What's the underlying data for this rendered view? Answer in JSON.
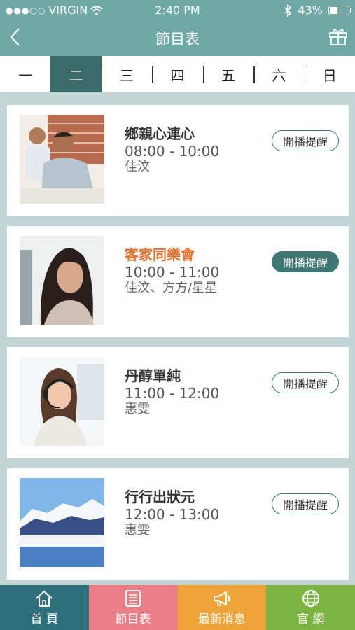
{
  "status": {
    "carrier": "VIRGIN",
    "time": "2:40 PM",
    "battery": "43%",
    "battery_level": 0.43
  },
  "nav": {
    "title": "節目表",
    "back_icon": "chevron-left-icon",
    "right_icon": "gift-icon"
  },
  "days": [
    {
      "label": "一",
      "active": false
    },
    {
      "label": "二",
      "active": true
    },
    {
      "label": "三",
      "active": false
    },
    {
      "label": "四",
      "active": false
    },
    {
      "label": "五",
      "active": false
    },
    {
      "label": "六",
      "active": false
    },
    {
      "label": "日",
      "active": false
    }
  ],
  "programs": [
    {
      "name": "鄉親心連心",
      "time": "08:00 - 10:00",
      "host": "佳汶",
      "remind": "開播提醒",
      "on_air": false
    },
    {
      "name": "客家同樂會",
      "time": "10:00 - 11:00",
      "host": "佳汶、方方/星星",
      "remind": "開播提醒",
      "on_air": true
    },
    {
      "name": "丹醇單純",
      "time": "11:00 - 12:00",
      "host": "惠雯",
      "remind": "開播提醒",
      "on_air": false
    },
    {
      "name": "行行出狀元",
      "time": "12:00 - 13:00",
      "host": "惠雯",
      "remind": "開播提醒",
      "on_air": false
    }
  ],
  "tabs": [
    {
      "label": "首 頁",
      "icon": "home-icon",
      "color": "#2f6f7c"
    },
    {
      "label": "節目表",
      "icon": "schedule-icon",
      "color": "#ea7d86"
    },
    {
      "label": "最新消息",
      "icon": "megaphone-icon",
      "color": "#eea33a"
    },
    {
      "label": "官 網",
      "icon": "globe-icon",
      "color": "#7cb342"
    }
  ],
  "colors": {
    "header": "#6fa8a4",
    "active_tab": "#3a6d69",
    "highlight": "#e8712f"
  }
}
